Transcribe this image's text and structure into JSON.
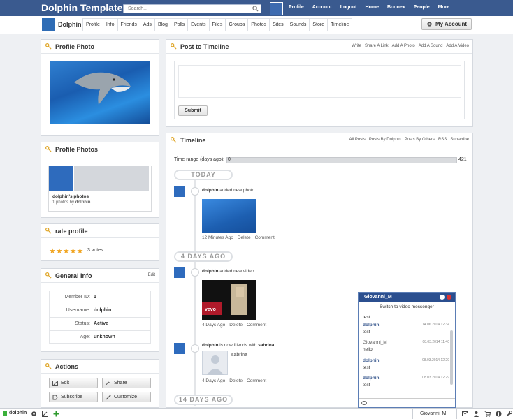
{
  "topbar": {
    "brand": "Dolphin Template",
    "search_placeholder": "Search...",
    "nav": [
      "Profile",
      "Account",
      "Logout",
      "Home",
      "Boonex",
      "People",
      "More"
    ]
  },
  "profile_bar": {
    "name": "Dolphin",
    "tabs": [
      "Profile",
      "Info",
      "Friends",
      "Ads",
      "Blog",
      "Polls",
      "Events",
      "Files",
      "Groups",
      "Photos",
      "Sites",
      "Sounds",
      "Store",
      "Timeline"
    ],
    "my_account": "My Account"
  },
  "profile_photo": {
    "title": "Profile Photo"
  },
  "profile_photos": {
    "title": "Profile Photos",
    "album": "dolphin's photos",
    "count_prefix": "1 photos by ",
    "count_author": "dolphin"
  },
  "rate": {
    "title": "rate profile",
    "stars": "★★★★★",
    "rating": 5,
    "votes": "3 votes"
  },
  "general_info": {
    "title": "General Info",
    "edit": "Edit",
    "rows": [
      {
        "label": "Member ID:",
        "value": "1"
      },
      {
        "label": "Username:",
        "value": "dolphin"
      },
      {
        "label": "Status:",
        "value": "Active"
      },
      {
        "label": "Age:",
        "value": "unknown"
      }
    ]
  },
  "actions": {
    "title": "Actions",
    "buttons": [
      "Edit",
      "Share",
      "Subscribe",
      "Customize"
    ]
  },
  "post": {
    "title": "Post to Timeline",
    "links": [
      "Write",
      "Share A Link",
      "Add A Photo",
      "Add A Sound",
      "Add A Video"
    ],
    "submit": "Submit"
  },
  "timeline": {
    "title": "Timeline",
    "links": [
      "All Posts",
      "Posts By Dolphin",
      "Posts By Others",
      "RSS",
      "Subscribe"
    ],
    "range_label": "Time range (days ago):",
    "range_min": "0",
    "range_max": "421",
    "dates": [
      "TODAY",
      "4 DAYS AGO",
      "14 DAYS AGO"
    ],
    "events": [
      {
        "actor": "dolphin",
        "action": "added new photo.",
        "time": "12 Minutes Ago",
        "delete": "Delete",
        "comment": "Comment"
      },
      {
        "actor": "dolphin",
        "action": "added new video.",
        "time": "4 Days Ago",
        "delete": "Delete",
        "comment": "Comment"
      },
      {
        "actor": "dolphin",
        "action": "is now friends with",
        "friend": "sabrina",
        "friend_caption": "sabrina",
        "time": "4 Days Ago",
        "delete": "Delete",
        "comment": "Comment"
      }
    ]
  },
  "chat": {
    "user": "Giovanni_M",
    "switch": "Switch to video messenger",
    "messages": [
      {
        "who": "",
        "ts": "",
        "text": "test"
      },
      {
        "who": "dolphin",
        "ts": "14.06.2014 12:34",
        "text": "test"
      },
      {
        "who": "Giovanni_M",
        "ts": "08.03.2014 11:40",
        "text": "hello"
      },
      {
        "who": "dolphin",
        "ts": "08.03.2014 12:29",
        "text": "test"
      },
      {
        "who": "dolphin",
        "ts": "08.03.2014 12:29",
        "text": "test"
      }
    ]
  },
  "bottombar": {
    "user": "dolphin",
    "chat_tab": "Giovanni_M"
  },
  "colors": {
    "topbar": "#3a5a8f",
    "link": "#3a5a8f",
    "star": "#f0a31c",
    "online": "#3bb03b"
  }
}
